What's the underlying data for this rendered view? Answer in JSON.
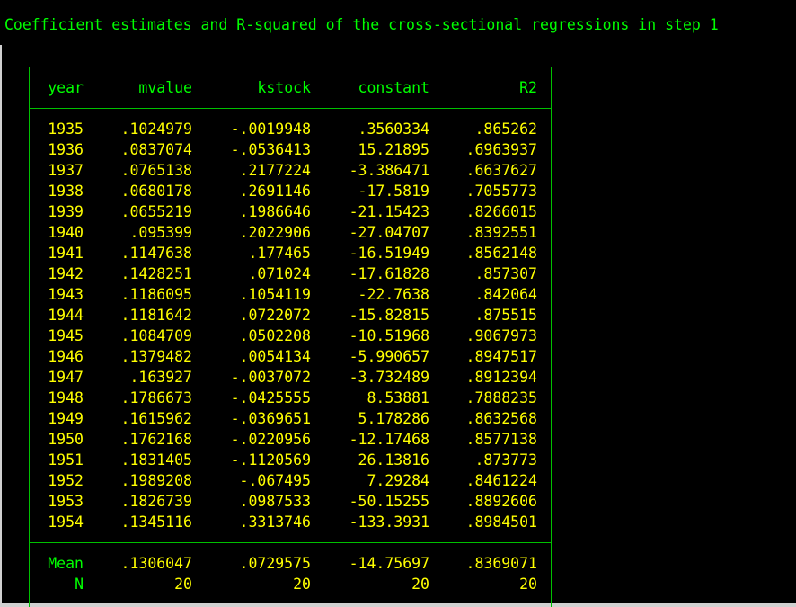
{
  "title": "Coefficient estimates and R-squared of the cross-sectional regressions in step 1",
  "colors": {
    "background": "#000000",
    "text_green": "#00ff00",
    "text_yellow": "#ffff00",
    "border": "#00c000"
  },
  "table": {
    "headers": [
      "year",
      "mvalue",
      "kstock",
      "constant",
      "R2"
    ],
    "rows": [
      [
        "1935",
        ".1024979",
        "-.0019948",
        ".3560334",
        ".865262"
      ],
      [
        "1936",
        ".0837074",
        "-.0536413",
        "15.21895",
        ".6963937"
      ],
      [
        "1937",
        ".0765138",
        ".2177224",
        "-3.386471",
        ".6637627"
      ],
      [
        "1938",
        ".0680178",
        ".2691146",
        "-17.5819",
        ".7055773"
      ],
      [
        "1939",
        ".0655219",
        ".1986646",
        "-21.15423",
        ".8266015"
      ],
      [
        "1940",
        ".095399",
        ".2022906",
        "-27.04707",
        ".8392551"
      ],
      [
        "1941",
        ".1147638",
        ".177465",
        "-16.51949",
        ".8562148"
      ],
      [
        "1942",
        ".1428251",
        ".071024",
        "-17.61828",
        ".857307"
      ],
      [
        "1943",
        ".1186095",
        ".1054119",
        "-22.7638",
        ".842064"
      ],
      [
        "1944",
        ".1181642",
        ".0722072",
        "-15.82815",
        ".875515"
      ],
      [
        "1945",
        ".1084709",
        ".0502208",
        "-10.51968",
        ".9067973"
      ],
      [
        "1946",
        ".1379482",
        ".0054134",
        "-5.990657",
        ".8947517"
      ],
      [
        "1947",
        ".163927",
        "-.0037072",
        "-3.732489",
        ".8912394"
      ],
      [
        "1948",
        ".1786673",
        "-.0425555",
        "8.53881",
        ".7888235"
      ],
      [
        "1949",
        ".1615962",
        "-.0369651",
        "5.178286",
        ".8632568"
      ],
      [
        "1950",
        ".1762168",
        "-.0220956",
        "-12.17468",
        ".8577138"
      ],
      [
        "1951",
        ".1831405",
        "-.1120569",
        "26.13816",
        ".873773"
      ],
      [
        "1952",
        ".1989208",
        "-.067495",
        "7.29284",
        ".8461224"
      ],
      [
        "1953",
        ".1826739",
        ".0987533",
        "-50.15255",
        ".8892606"
      ],
      [
        "1954",
        ".1345116",
        ".3313746",
        "-133.3931",
        ".8984501"
      ]
    ],
    "summary": [
      [
        "Mean",
        ".1306047",
        ".0729575",
        "-14.75697",
        ".8369071"
      ],
      [
        "N",
        "20",
        "20",
        "20",
        "20"
      ]
    ]
  }
}
